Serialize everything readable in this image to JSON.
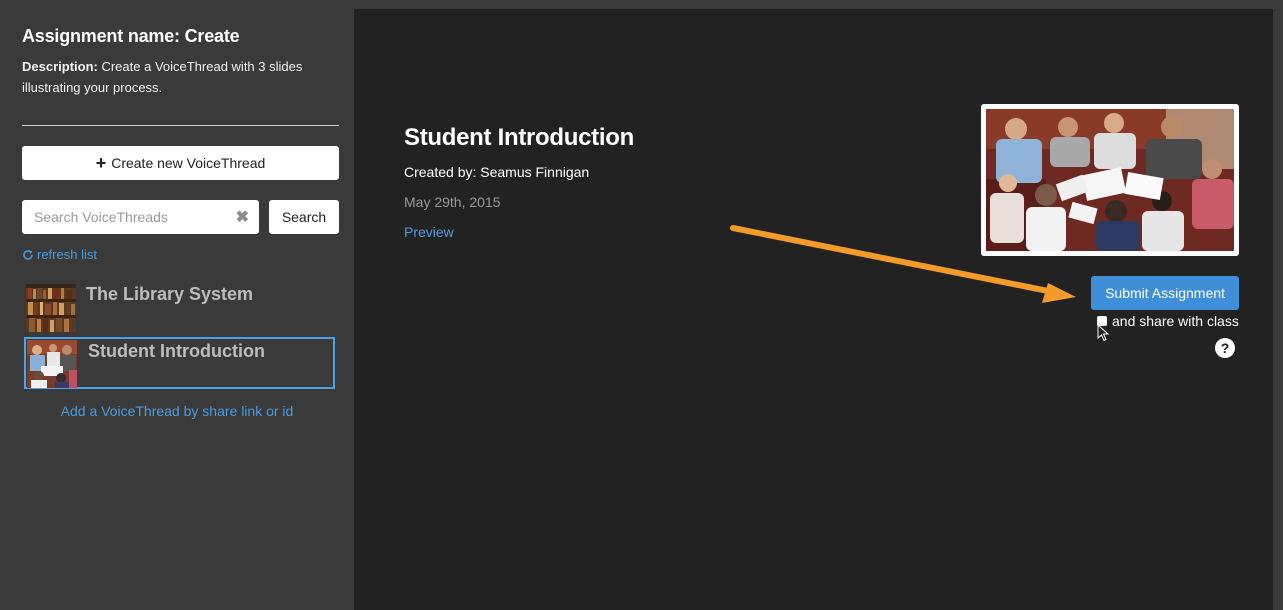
{
  "sidebar": {
    "assignment_title": "Assignment name: Create",
    "description_label": "Description:",
    "description_text": "Create a VoiceThread with 3 slides illustrating your process.",
    "create_button": "Create new VoiceThread",
    "create_icon": "plus-icon",
    "search_placeholder": "Search VoiceThreads",
    "search_value": "",
    "clear_icon": "clear-x-icon",
    "search_button": "Search",
    "refresh_label": "refresh list",
    "refresh_icon": "refresh-icon",
    "items": [
      {
        "label": "The Library System",
        "thumb": "library-bookshelf-thumbnail",
        "selected": false
      },
      {
        "label": "Student Introduction",
        "thumb": "students-group-thumbnail",
        "selected": true
      }
    ],
    "add_link": "Add a VoiceThread by share link or id"
  },
  "main": {
    "title": "Student Introduction",
    "created_by": "Created by: Seamus Finnigan",
    "date": "May 29th, 2015",
    "preview_link": "Preview",
    "cover_image": "students-discussion-photo",
    "submit_button": "Submit Assignment",
    "share_label": "and share with class",
    "share_checked": false,
    "help_icon": "?",
    "annotation": "orange-arrow-pointing-to-submit"
  },
  "colors": {
    "sidebar_bg": "#3a3a3b",
    "main_bg": "#222223",
    "link_blue": "#4a9be0",
    "button_blue": "#3f8ed8",
    "arrow_orange": "#f39a2a",
    "selected_border": "#4ea3e6"
  }
}
